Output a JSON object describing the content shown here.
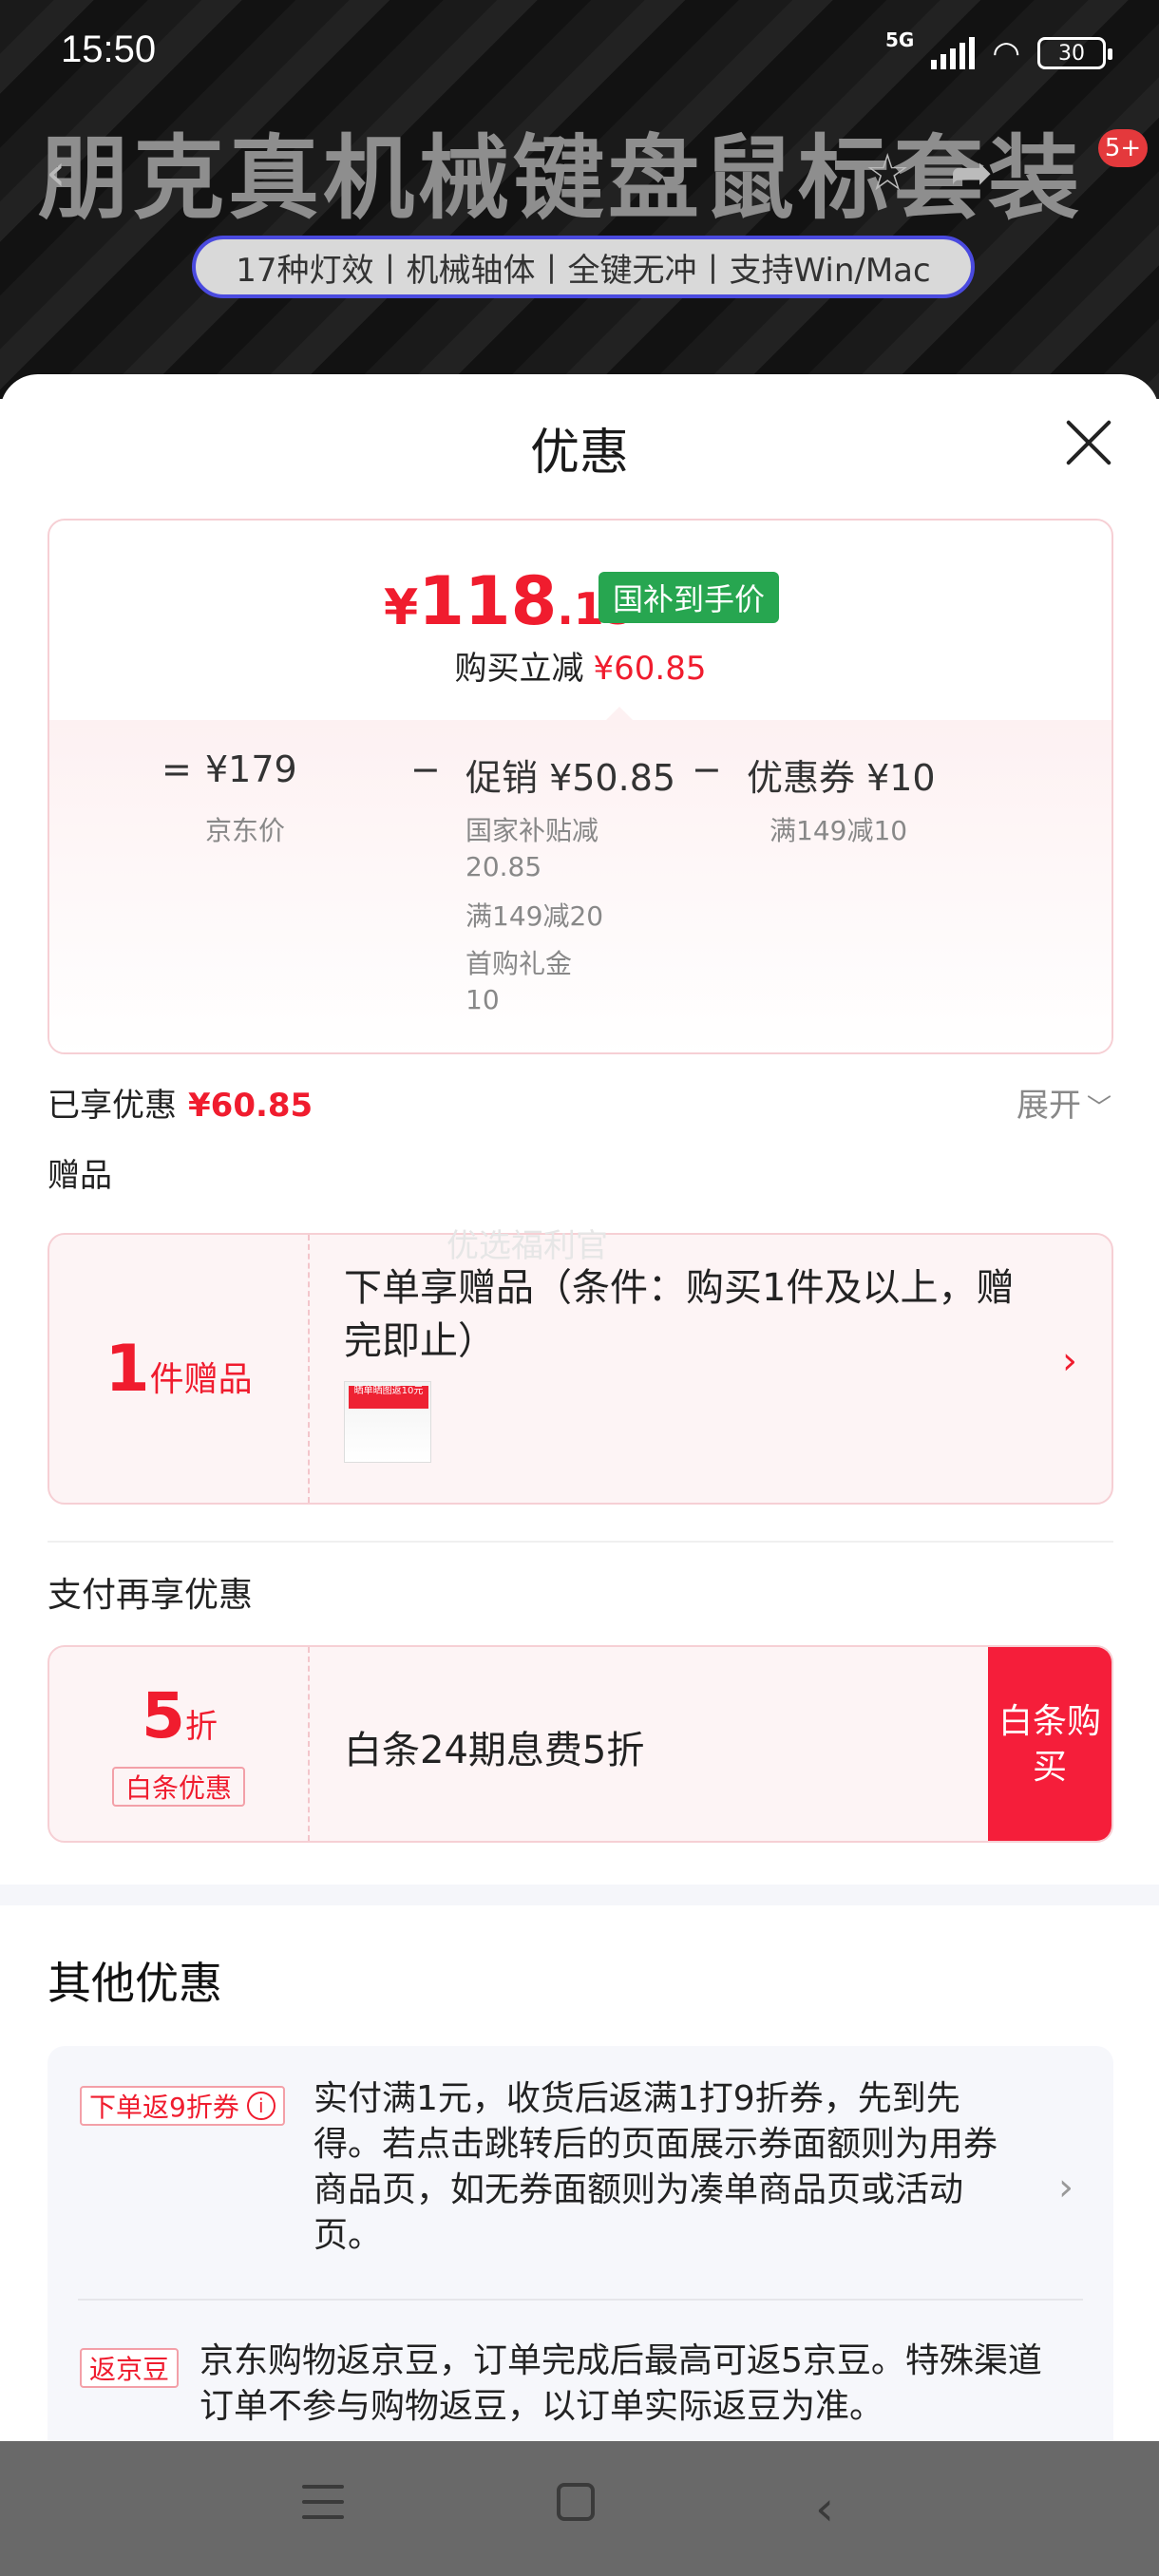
{
  "status": {
    "time": "15:50",
    "network": "5G",
    "battery": "30"
  },
  "background": {
    "title": "朋克真机械键盘鼠标套装",
    "subtitle": "17种灯效丨机械轴体丨全键无冲丨支持Win/Mac",
    "badge": "5+",
    "icons": [
      "back-icon",
      "star-icon",
      "share-icon"
    ]
  },
  "sheet": {
    "title": "优惠"
  },
  "price": {
    "symbol": "¥",
    "integer": "118",
    "decimal": ".15",
    "badge": "国补到手价",
    "save_label": "购买立减",
    "save_value": "¥60.85",
    "calc": {
      "eq": "=",
      "base_value": "¥179",
      "base_label": "京东价",
      "minus1": "−",
      "promo_value": "促销 ¥50.85",
      "promo_items": [
        "国家补贴减20.85",
        "满149减20",
        "首购礼金10"
      ],
      "minus2": "−",
      "coupon_value": "优惠券 ¥10",
      "coupon_item": "满149减10"
    }
  },
  "enjoyed": {
    "label": "已享优惠",
    "value": "¥60.85",
    "expand": "展开"
  },
  "gift": {
    "section_label": "赠品",
    "watermark": "优选福利官",
    "count": "1",
    "count_unit": "件赠品",
    "description": "下单享赠品（条件：购买1件及以上，赠完即止）",
    "thumb_text": "晒单晒图返10元"
  },
  "pay": {
    "section_label": "支付再享优惠",
    "discount_number": "5",
    "discount_unit": "折",
    "tag": "白条优惠",
    "description": "白条24期息费5折",
    "button": "白条购买"
  },
  "other": {
    "title": "其他优惠",
    "items": [
      {
        "tag": "下单返9折券",
        "text": "实付满1元，收货后返满1打9折券，先到先得。若点击跳转后的页面展示券面额则为用券商品页，如无券面额则为凑单商品页或活动页。"
      },
      {
        "tag": "返京豆",
        "text": "京东购物返京豆，订单完成后最高可返5京豆。特殊渠道订单不参与购物返豆，以订单实际返豆为准。"
      }
    ]
  },
  "colors": {
    "accent": "#f01c2e",
    "green_badge": "#27a650",
    "pay_button": "#f51e3a"
  }
}
